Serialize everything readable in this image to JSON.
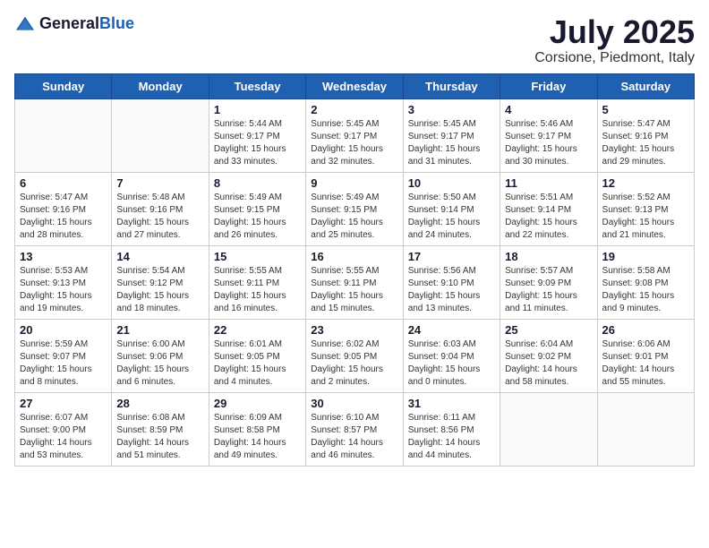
{
  "header": {
    "logo_general": "General",
    "logo_blue": "Blue",
    "month_year": "July 2025",
    "location": "Corsione, Piedmont, Italy"
  },
  "days_of_week": [
    "Sunday",
    "Monday",
    "Tuesday",
    "Wednesday",
    "Thursday",
    "Friday",
    "Saturday"
  ],
  "weeks": [
    [
      {
        "day": "",
        "info": ""
      },
      {
        "day": "",
        "info": ""
      },
      {
        "day": "1",
        "info": "Sunrise: 5:44 AM\nSunset: 9:17 PM\nDaylight: 15 hours and 33 minutes."
      },
      {
        "day": "2",
        "info": "Sunrise: 5:45 AM\nSunset: 9:17 PM\nDaylight: 15 hours and 32 minutes."
      },
      {
        "day": "3",
        "info": "Sunrise: 5:45 AM\nSunset: 9:17 PM\nDaylight: 15 hours and 31 minutes."
      },
      {
        "day": "4",
        "info": "Sunrise: 5:46 AM\nSunset: 9:17 PM\nDaylight: 15 hours and 30 minutes."
      },
      {
        "day": "5",
        "info": "Sunrise: 5:47 AM\nSunset: 9:16 PM\nDaylight: 15 hours and 29 minutes."
      }
    ],
    [
      {
        "day": "6",
        "info": "Sunrise: 5:47 AM\nSunset: 9:16 PM\nDaylight: 15 hours and 28 minutes."
      },
      {
        "day": "7",
        "info": "Sunrise: 5:48 AM\nSunset: 9:16 PM\nDaylight: 15 hours and 27 minutes."
      },
      {
        "day": "8",
        "info": "Sunrise: 5:49 AM\nSunset: 9:15 PM\nDaylight: 15 hours and 26 minutes."
      },
      {
        "day": "9",
        "info": "Sunrise: 5:49 AM\nSunset: 9:15 PM\nDaylight: 15 hours and 25 minutes."
      },
      {
        "day": "10",
        "info": "Sunrise: 5:50 AM\nSunset: 9:14 PM\nDaylight: 15 hours and 24 minutes."
      },
      {
        "day": "11",
        "info": "Sunrise: 5:51 AM\nSunset: 9:14 PM\nDaylight: 15 hours and 22 minutes."
      },
      {
        "day": "12",
        "info": "Sunrise: 5:52 AM\nSunset: 9:13 PM\nDaylight: 15 hours and 21 minutes."
      }
    ],
    [
      {
        "day": "13",
        "info": "Sunrise: 5:53 AM\nSunset: 9:13 PM\nDaylight: 15 hours and 19 minutes."
      },
      {
        "day": "14",
        "info": "Sunrise: 5:54 AM\nSunset: 9:12 PM\nDaylight: 15 hours and 18 minutes."
      },
      {
        "day": "15",
        "info": "Sunrise: 5:55 AM\nSunset: 9:11 PM\nDaylight: 15 hours and 16 minutes."
      },
      {
        "day": "16",
        "info": "Sunrise: 5:55 AM\nSunset: 9:11 PM\nDaylight: 15 hours and 15 minutes."
      },
      {
        "day": "17",
        "info": "Sunrise: 5:56 AM\nSunset: 9:10 PM\nDaylight: 15 hours and 13 minutes."
      },
      {
        "day": "18",
        "info": "Sunrise: 5:57 AM\nSunset: 9:09 PM\nDaylight: 15 hours and 11 minutes."
      },
      {
        "day": "19",
        "info": "Sunrise: 5:58 AM\nSunset: 9:08 PM\nDaylight: 15 hours and 9 minutes."
      }
    ],
    [
      {
        "day": "20",
        "info": "Sunrise: 5:59 AM\nSunset: 9:07 PM\nDaylight: 15 hours and 8 minutes."
      },
      {
        "day": "21",
        "info": "Sunrise: 6:00 AM\nSunset: 9:06 PM\nDaylight: 15 hours and 6 minutes."
      },
      {
        "day": "22",
        "info": "Sunrise: 6:01 AM\nSunset: 9:05 PM\nDaylight: 15 hours and 4 minutes."
      },
      {
        "day": "23",
        "info": "Sunrise: 6:02 AM\nSunset: 9:05 PM\nDaylight: 15 hours and 2 minutes."
      },
      {
        "day": "24",
        "info": "Sunrise: 6:03 AM\nSunset: 9:04 PM\nDaylight: 15 hours and 0 minutes."
      },
      {
        "day": "25",
        "info": "Sunrise: 6:04 AM\nSunset: 9:02 PM\nDaylight: 14 hours and 58 minutes."
      },
      {
        "day": "26",
        "info": "Sunrise: 6:06 AM\nSunset: 9:01 PM\nDaylight: 14 hours and 55 minutes."
      }
    ],
    [
      {
        "day": "27",
        "info": "Sunrise: 6:07 AM\nSunset: 9:00 PM\nDaylight: 14 hours and 53 minutes."
      },
      {
        "day": "28",
        "info": "Sunrise: 6:08 AM\nSunset: 8:59 PM\nDaylight: 14 hours and 51 minutes."
      },
      {
        "day": "29",
        "info": "Sunrise: 6:09 AM\nSunset: 8:58 PM\nDaylight: 14 hours and 49 minutes."
      },
      {
        "day": "30",
        "info": "Sunrise: 6:10 AM\nSunset: 8:57 PM\nDaylight: 14 hours and 46 minutes."
      },
      {
        "day": "31",
        "info": "Sunrise: 6:11 AM\nSunset: 8:56 PM\nDaylight: 14 hours and 44 minutes."
      },
      {
        "day": "",
        "info": ""
      },
      {
        "day": "",
        "info": ""
      }
    ]
  ]
}
